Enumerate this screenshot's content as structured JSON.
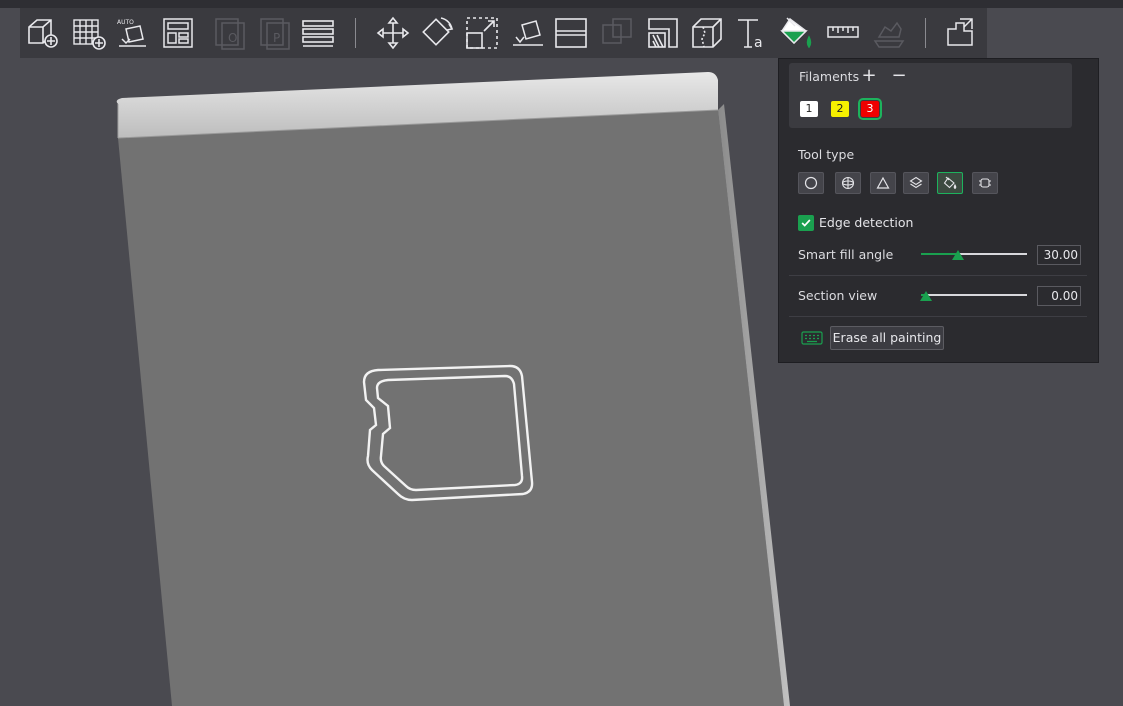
{
  "toolbar": {
    "icons": [
      "add-object-icon",
      "add-plate-icon",
      "auto-orient-icon",
      "arrange-icon",
      "object-list-icon",
      "plate-list-icon",
      "layers-icon",
      "move-icon",
      "rotate-icon",
      "scale-icon",
      "lay-on-face-icon",
      "cut-icon",
      "boolean-icon",
      "support-paint-icon",
      "seam-paint-icon",
      "text-icon",
      "color-paint-icon",
      "measure-icon",
      "assembly-icon",
      "assembly-view-icon"
    ]
  },
  "panel": {
    "filaments_title": "Filaments",
    "add_symbol": "+",
    "remove_symbol": "−",
    "filaments": [
      {
        "label": "1",
        "color": "#ffffff"
      },
      {
        "label": "2",
        "color": "#f6f000"
      },
      {
        "label": "3",
        "color": "#ee0000",
        "selected": true
      }
    ],
    "tool_type_title": "Tool type",
    "tools": [
      "circle-tool-icon",
      "sphere-tool-icon",
      "triangle-tool-icon",
      "height-range-tool-icon",
      "fill-tool-icon",
      "gap-fill-tool-icon"
    ],
    "active_tool": "fill-tool-icon",
    "edge_detection_label": "Edge detection",
    "edge_detection_checked": true,
    "smart_fill_label": "Smart fill angle",
    "smart_fill_value": "30.00",
    "smart_fill_fraction": 0.35,
    "section_view_label": "Section view",
    "section_view_value": "0.00",
    "section_view_fraction": 0.05,
    "erase_label": "Erase all painting",
    "accent_color": "#1aa04f"
  }
}
